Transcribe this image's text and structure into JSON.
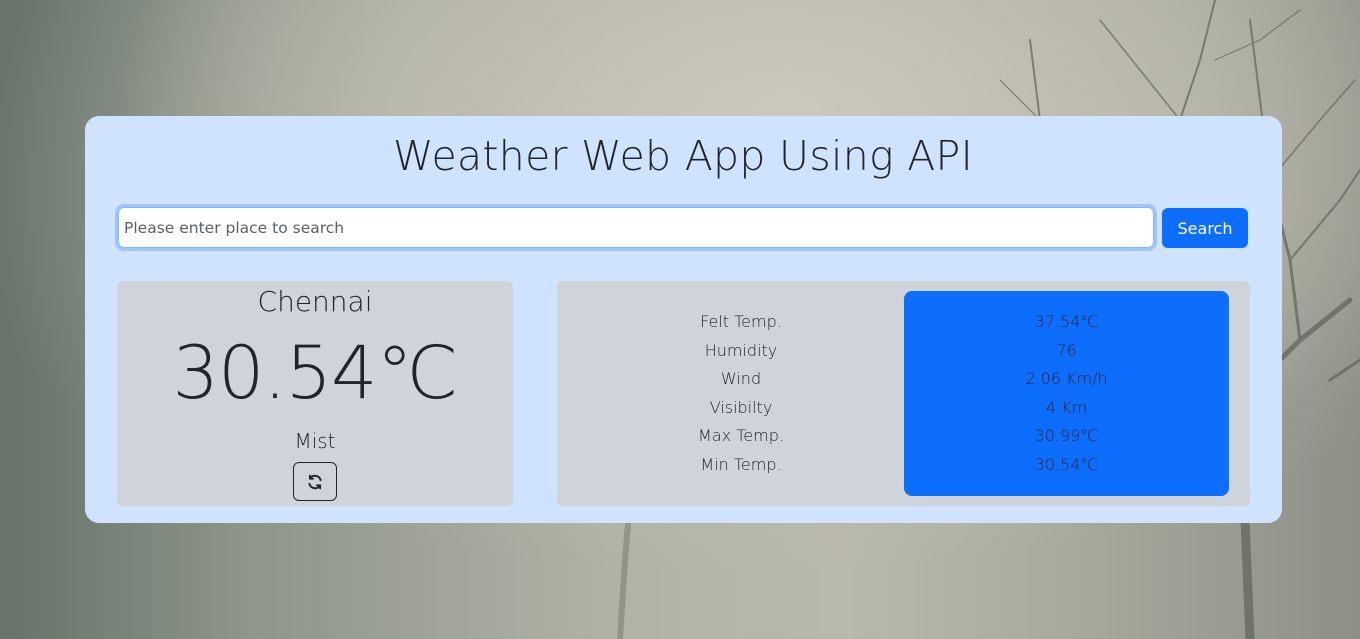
{
  "app": {
    "title": "Weather Web App Using API"
  },
  "search": {
    "placeholder": "Please enter place to search",
    "value": "",
    "button_label": "Search"
  },
  "current": {
    "city": "Chennai",
    "temperature": "30.54℃",
    "condition": "Mist",
    "refresh_icon": "refresh-icon"
  },
  "details": [
    {
      "label": "Felt Temp.",
      "value": "37.54℃"
    },
    {
      "label": "Humidity",
      "value": "76"
    },
    {
      "label": "Wind",
      "value": "2.06 Km/h"
    },
    {
      "label": "Visibilty",
      "value": "4 Km"
    },
    {
      "label": "Max Temp.",
      "value": "30.99℃"
    },
    {
      "label": "Min Temp.",
      "value": "30.54℃"
    }
  ],
  "colors": {
    "card_background": "#cfe2fe",
    "panel_background": "#cfd4da",
    "accent": "#0d6efd"
  }
}
